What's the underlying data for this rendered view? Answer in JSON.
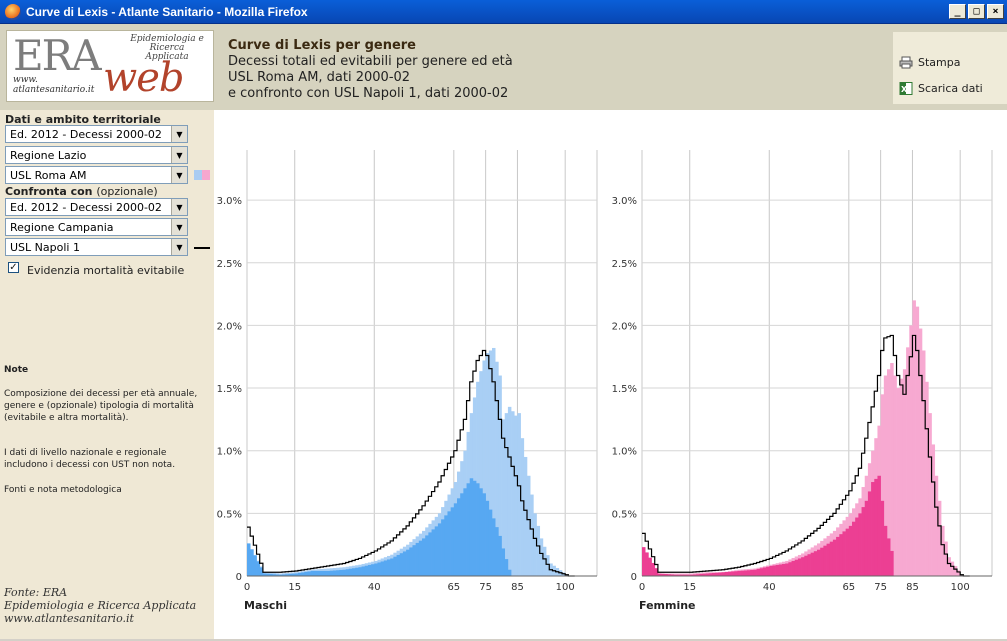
{
  "window": {
    "title": "Curve di Lexis - Atlante Sanitario - Mozilla Firefox"
  },
  "logo": {
    "era": "ERA",
    "web": "web",
    "tagline": "Epidemiologia e Ricerca Applicata",
    "url_prefix": "www.",
    "url": "atlantesanitario.it"
  },
  "header": {
    "title": "Curve di Lexis per genere",
    "line1": "Decessi totali ed evitabili per genere ed età",
    "line2": "USL Roma AM, dati 2000-02",
    "line3": "e confronto con USL Napoli 1, dati 2000-02"
  },
  "tools": {
    "print": "Stampa",
    "download": "Scarica dati"
  },
  "sidebar": {
    "section1_label": "Dati e ambito territoriale",
    "edition": "Ed. 2012 - Decessi 2000-02",
    "region": "Regione Lazio",
    "usl": "USL Roma AM",
    "compare_label": "Confronta con",
    "compare_optional": "(opzionale)",
    "cmp_edition": "Ed. 2012 - Decessi 2000-02",
    "cmp_region": "Regione Campania",
    "cmp_usl": "USL Napoli 1",
    "highlight_label": "Evidenzia mortalità evitabile",
    "highlight_checked": true
  },
  "notes": {
    "heading": "Note",
    "p1": "Composizione dei decessi per età annuale, genere e (opzionale) tipologia di mortalità (evitabile e altra mortalità).",
    "p2": "I dati di livello nazionale e regionale includono i decessi con UST non nota.",
    "p3": "Fonti e nota metodologica"
  },
  "footer": {
    "line1": "Fonte: ERA",
    "line2": "Epidemiologia e Ricerca Applicata",
    "line3": "www.atlantesanitario.it"
  },
  "colors": {
    "male_total": "#a9cff5",
    "male_avoidable": "#57a8f2",
    "female_total": "#f7a9d1",
    "female_avoidable": "#ec3f93",
    "compare_line": "#000000"
  },
  "chart_data": [
    {
      "type": "bar",
      "title": "Maschi",
      "ylim": [
        0,
        3.4
      ],
      "yticks": [
        "0",
        "0.5%",
        "1.0%",
        "1.5%",
        "2.0%",
        "2.5%",
        "3.0%"
      ],
      "xticks": [
        "0",
        "15",
        "40",
        "65",
        "75",
        "85",
        "100"
      ],
      "grid": true,
      "series": [
        {
          "name": "USL Roma AM - totale",
          "ages": [
            0,
            5,
            10,
            15,
            20,
            25,
            30,
            35,
            40,
            45,
            50,
            55,
            60,
            65,
            68,
            70,
            72,
            74,
            75,
            77,
            79,
            80,
            82,
            84,
            85,
            86,
            88,
            90,
            92,
            95,
            100
          ],
          "values": [
            0.26,
            0.03,
            0.02,
            0.03,
            0.05,
            0.06,
            0.07,
            0.09,
            0.12,
            0.17,
            0.25,
            0.36,
            0.5,
            0.75,
            1.0,
            1.3,
            1.55,
            1.72,
            1.78,
            1.82,
            1.6,
            1.25,
            1.35,
            1.28,
            1.3,
            1.1,
            0.8,
            0.5,
            0.3,
            0.1,
            0.01
          ]
        },
        {
          "name": "USL Roma AM - evitabile",
          "ages": [
            0,
            5,
            10,
            15,
            20,
            25,
            30,
            35,
            40,
            45,
            50,
            55,
            60,
            65,
            68,
            70,
            72,
            74,
            75,
            77,
            79,
            80,
            82
          ],
          "values": [
            0.26,
            0.02,
            0.01,
            0.02,
            0.04,
            0.04,
            0.05,
            0.07,
            0.1,
            0.14,
            0.21,
            0.3,
            0.42,
            0.58,
            0.7,
            0.78,
            0.74,
            0.66,
            0.6,
            0.46,
            0.32,
            0.22,
            0.05
          ]
        },
        {
          "name": "USL Napoli 1",
          "ages": [
            0,
            5,
            10,
            15,
            20,
            25,
            30,
            35,
            40,
            45,
            50,
            55,
            60,
            65,
            68,
            70,
            72,
            74,
            75,
            77,
            79,
            80,
            82,
            84,
            85,
            86,
            88,
            90,
            92,
            95,
            100
          ],
          "values": [
            0.39,
            0.03,
            0.03,
            0.04,
            0.06,
            0.08,
            0.1,
            0.14,
            0.2,
            0.28,
            0.4,
            0.56,
            0.75,
            1.0,
            1.25,
            1.55,
            1.72,
            1.8,
            1.76,
            1.55,
            1.25,
            1.1,
            0.95,
            0.8,
            0.72,
            0.6,
            0.45,
            0.3,
            0.18,
            0.05,
            0.01
          ]
        }
      ]
    },
    {
      "type": "bar",
      "title": "Femmine",
      "ylim": [
        0,
        3.4
      ],
      "yticks": [
        "0",
        "0.5%",
        "1.0%",
        "1.5%",
        "2.0%",
        "2.5%",
        "3.0%"
      ],
      "xticks": [
        "0",
        "15",
        "40",
        "65",
        "75",
        "85",
        "100"
      ],
      "grid": true,
      "series": [
        {
          "name": "USL Roma AM - totale",
          "ages": [
            0,
            5,
            10,
            15,
            20,
            25,
            30,
            35,
            40,
            45,
            50,
            55,
            60,
            65,
            68,
            70,
            72,
            74,
            75,
            76,
            78,
            80,
            82,
            84,
            85,
            86,
            88,
            90,
            92,
            94,
            96,
            100
          ],
          "values": [
            0.23,
            0.02,
            0.02,
            0.02,
            0.03,
            0.03,
            0.05,
            0.06,
            0.09,
            0.12,
            0.18,
            0.26,
            0.36,
            0.5,
            0.62,
            0.8,
            1.0,
            1.2,
            1.45,
            1.6,
            1.7,
            1.5,
            1.65,
            2.0,
            2.2,
            2.15,
            1.8,
            1.3,
            0.8,
            0.4,
            0.15,
            0.01
          ]
        },
        {
          "name": "USL Roma AM - evitabile",
          "ages": [
            0,
            5,
            10,
            15,
            20,
            25,
            30,
            35,
            40,
            45,
            50,
            55,
            60,
            65,
            68,
            70,
            72,
            74,
            75,
            76,
            78
          ],
          "values": [
            0.23,
            0.02,
            0.01,
            0.01,
            0.02,
            0.03,
            0.04,
            0.05,
            0.08,
            0.1,
            0.15,
            0.21,
            0.29,
            0.4,
            0.5,
            0.6,
            0.75,
            0.8,
            0.6,
            0.4,
            0.2
          ]
        },
        {
          "name": "USL Napoli 1",
          "ages": [
            0,
            5,
            10,
            15,
            20,
            25,
            30,
            35,
            40,
            45,
            50,
            55,
            60,
            65,
            68,
            70,
            72,
            74,
            75,
            76,
            78,
            80,
            82,
            84,
            85,
            86,
            88,
            90,
            92,
            94,
            96,
            100
          ],
          "values": [
            0.34,
            0.03,
            0.03,
            0.03,
            0.04,
            0.05,
            0.07,
            0.1,
            0.14,
            0.2,
            0.28,
            0.38,
            0.5,
            0.68,
            0.86,
            1.1,
            1.35,
            1.6,
            1.8,
            1.9,
            1.92,
            1.6,
            1.45,
            1.75,
            1.92,
            1.8,
            1.4,
            0.95,
            0.55,
            0.25,
            0.1,
            0.01
          ]
        }
      ]
    }
  ]
}
